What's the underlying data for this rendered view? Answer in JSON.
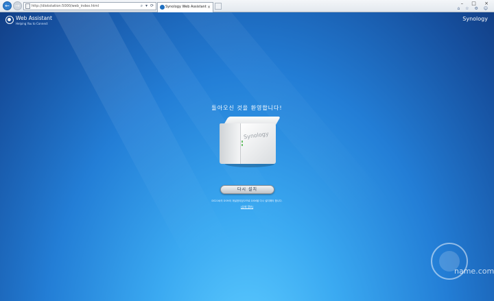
{
  "browser": {
    "address_url": "http://diskstation:5000/web_index.html",
    "address_tools": "⌕ ▾ ⟳",
    "tab_title": "Synology Web Assistant",
    "tab_close": "×",
    "back_icon": "←",
    "forward_icon": "→",
    "window_controls": "– □ ×",
    "toolbar_icons": "⌂ ☆ ⚙ ☺"
  },
  "app": {
    "logo_title": "Web Assistant",
    "logo_subtitle": "Helping You to Connect",
    "brand": "Synology",
    "welcome": "돌아오신 것을 환영합니다!",
    "device_brand": "Synology",
    "reinstall_button": "다시 설치",
    "description": "DS216j의 DSM이 재설정되었으므로 DSM을 다시 설치해야 합니다.",
    "details_link": "[상세 정보]"
  },
  "watermark": {
    "text": "name.com"
  },
  "colors": {
    "background_top": "#123f86",
    "background_bottom": "#5ccbff",
    "button_text": "#1c2c45"
  }
}
